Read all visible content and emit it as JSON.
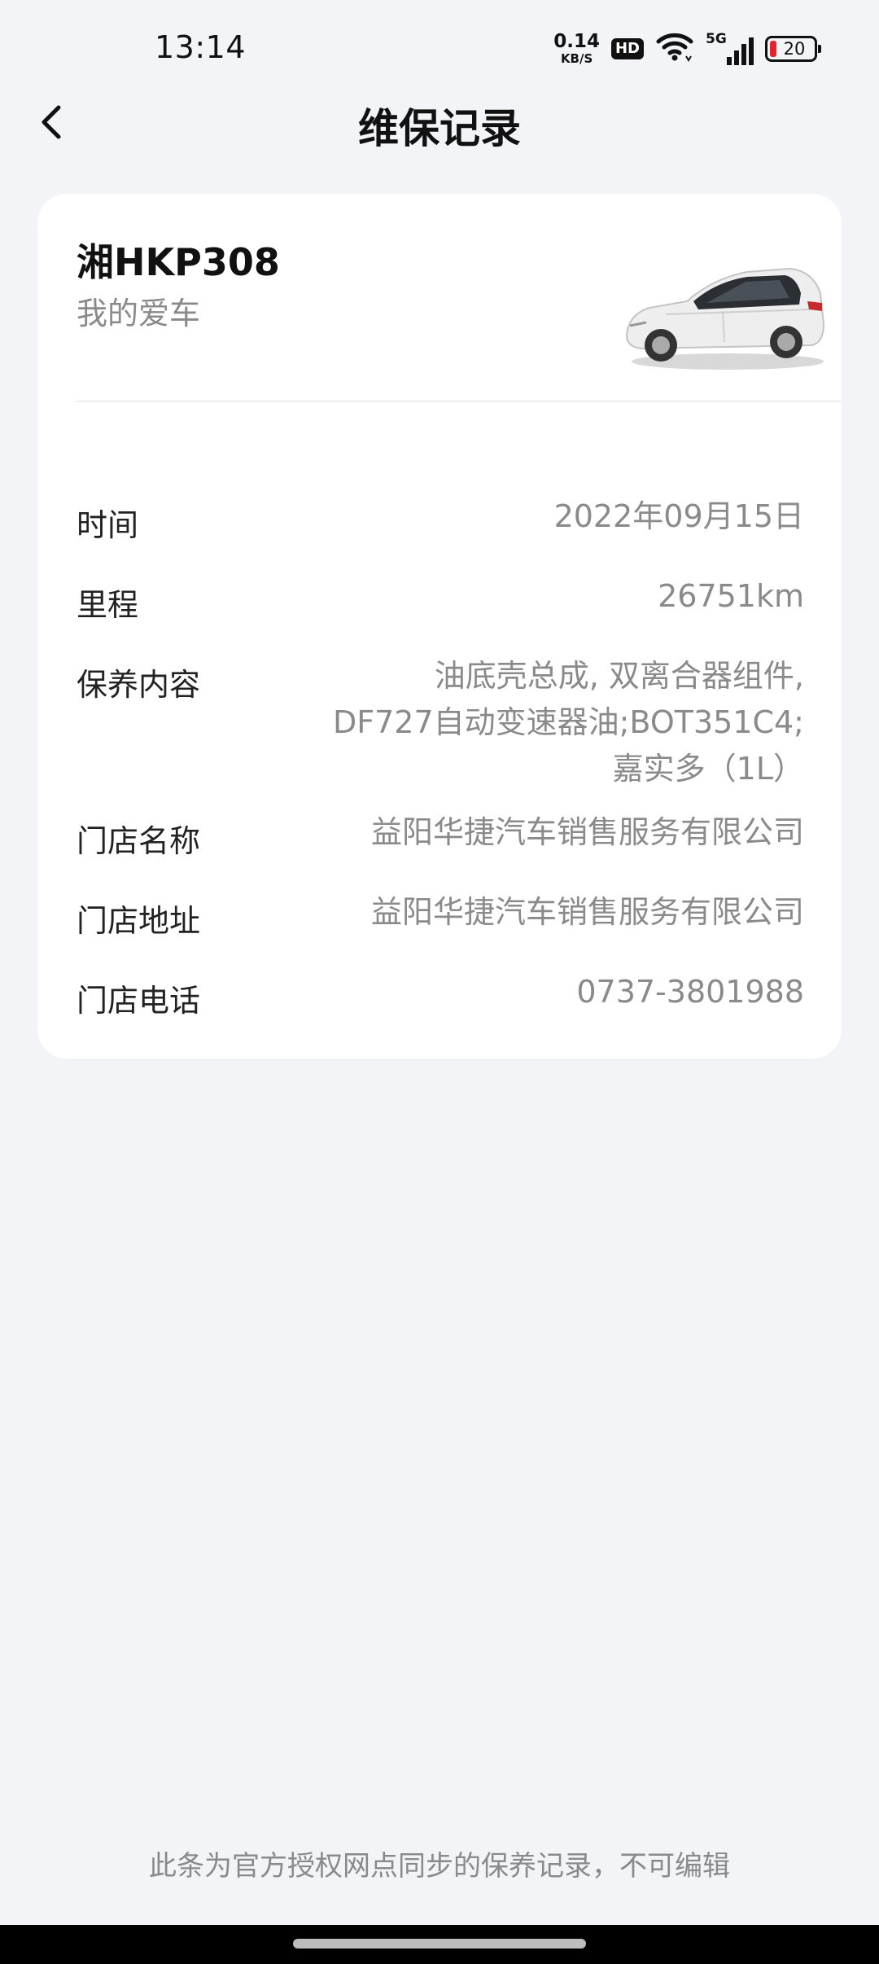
{
  "status_bar": {
    "time": "13:14",
    "net_speed_value": "0.14",
    "net_speed_unit": "KB/S",
    "hd_label": "HD",
    "network_label": "5G",
    "battery_level": "20",
    "battery_color": "#e2242f"
  },
  "header": {
    "title": "维保记录"
  },
  "vehicle": {
    "plate": "湘HKP308",
    "label": "我的爱车",
    "image_icon": "car-image"
  },
  "record": {
    "rows": [
      {
        "label": "时间",
        "value": "2022年09月15日"
      },
      {
        "label": "里程",
        "value": "26751km"
      },
      {
        "label": "保养内容",
        "value_lines": [
          "油底壳总成, 双离合器组件,",
          "DF727自动变速器油;BOT351C4;",
          "嘉实多（1L）"
        ]
      },
      {
        "label": "门店名称",
        "value": "益阳华捷汽车销售服务有限公司"
      },
      {
        "label": "门店地址",
        "value": "益阳华捷汽车销售服务有限公司"
      },
      {
        "label": "门店电话",
        "value": "0737-3801988"
      }
    ]
  },
  "footer": {
    "note": "此条为官方授权网点同步的保养记录，不可编辑"
  }
}
